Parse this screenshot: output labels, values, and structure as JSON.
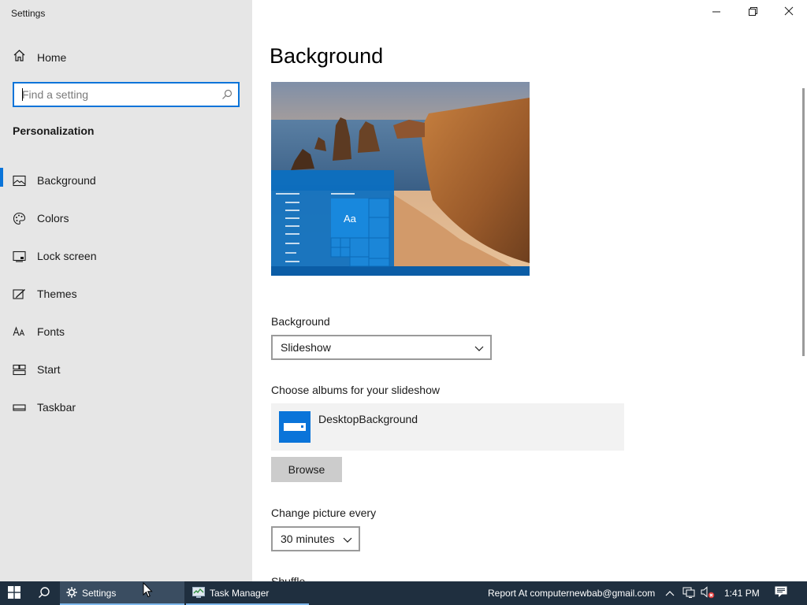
{
  "window": {
    "title": "Settings",
    "controls": [
      "minimize",
      "maximize",
      "close"
    ]
  },
  "sidebar": {
    "home_label": "Home",
    "search_placeholder": "Find a setting",
    "section_label": "Personalization",
    "items": [
      {
        "label": "Background",
        "icon": "picture-icon",
        "active": true
      },
      {
        "label": "Colors",
        "icon": "palette-icon",
        "active": false
      },
      {
        "label": "Lock screen",
        "icon": "lock-screen-icon",
        "active": false
      },
      {
        "label": "Themes",
        "icon": "brush-icon",
        "active": false
      },
      {
        "label": "Fonts",
        "icon": "font-icon",
        "active": false
      },
      {
        "label": "Start",
        "icon": "start-icon",
        "active": false
      },
      {
        "label": "Taskbar",
        "icon": "taskbar-icon",
        "active": false
      }
    ]
  },
  "main": {
    "title": "Background",
    "preview_tile_text": "Aa",
    "background_label": "Background",
    "background_value": "Slideshow",
    "albums_label": "Choose albums for your slideshow",
    "album_name": "DesktopBackground",
    "browse_label": "Browse",
    "change_picture_label": "Change picture every",
    "change_picture_value": "30 minutes",
    "shuffle_label": "Shuffle"
  },
  "taskbar": {
    "apps": [
      {
        "label": "Settings",
        "icon": "gear-icon",
        "active": true
      },
      {
        "label": "Task Manager",
        "icon": "task-manager-icon",
        "active": false
      }
    ],
    "tray_text": "Report At computernewbab@gmail.com",
    "time": "1:41 PM"
  },
  "colors": {
    "accent": "#0a74d9",
    "sidebar_bg": "#e6e6e6",
    "taskbar_bg": "#1f2f3f"
  }
}
